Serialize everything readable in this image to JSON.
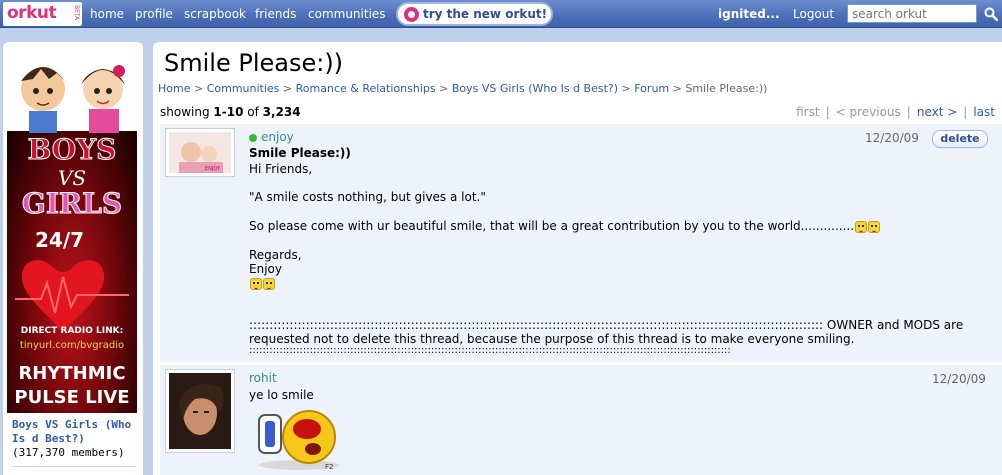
{
  "header": {
    "logo": "orkut",
    "logo_beta": "BETA",
    "nav": [
      "home",
      "profile",
      "scrapbook",
      "friends",
      "communities"
    ],
    "try_new": "try the new orkut!",
    "user": "ignited...",
    "logout": "Logout",
    "search_placeholder": "search orkut"
  },
  "sidebar": {
    "banner": {
      "title_line1": "BOYS",
      "title_vs": "VS",
      "title_line2": "GIRLS",
      "schedule": "24/7",
      "radio_label": "DIRECT RADIO LINK:",
      "radio_url": "tinyurl.com/bvgradio",
      "station_line1": "RHYTHMIC",
      "station_line2": "PULSE LIVE"
    },
    "community_name": "Boys VS Girls (Who Is d Best?)",
    "members": "(317,370 members)"
  },
  "main": {
    "title": "Smile Please:))",
    "breadcrumb": [
      "Home",
      "Communities",
      "Romance & Relationships",
      "Boys VS Girls (Who Is d Best?)",
      "Forum"
    ],
    "breadcrumb_sep": ">",
    "breadcrumb_current": "Smile Please:))",
    "showing_prefix": "showing",
    "showing_range": "1-10",
    "showing_of": "of",
    "showing_total": "3,234",
    "pager": {
      "first": "first",
      "previous": "< previous",
      "next": "next >",
      "last": "last",
      "sep": "|"
    }
  },
  "posts": [
    {
      "author": "enjoy",
      "date": "12/20/09",
      "delete_label": "delete",
      "subject": "Smile Please:))",
      "lines": [
        "Hi Friends,",
        "\"A smile costs nothing, but gives a lot.\"",
        "So please come with ur beautiful smile, that will be a great contribution by you to the world..............",
        "Regards,",
        "Enjoy",
        ":::::::::::::::::::::::::::::::::::::::::::::::::::::::::::::::::::::::::::::::::::::::::::::::::::::::::::::::::::::::::::::::::::::::::::::: OWNER and MODS are",
        "requested not to delete this thread, because the purpose of this thread is to make everyone smiling.",
        ":::::::::::::::::::::::::::::::::::::::::::::::::::::::::::::::::::::::::::::::::::::::::::::::::::::::::::::::::::::::::::::::::::::::::::::::"
      ],
      "thumb_caption": "ENJOY"
    },
    {
      "author": "rohit",
      "date": "12/20/09",
      "lines": [
        "ye lo smile"
      ],
      "image_caption": "F2"
    }
  ],
  "colors": {
    "topbar": "#4a6fb8",
    "page_bg": "#bfd0ea",
    "link": "#2f5aa8",
    "author_link": "#2f8a9a",
    "post_bg": "#eef3fb",
    "brand_pink": "#e0307b"
  },
  "icons": [
    "search-icon",
    "online-status-icon",
    "smiley-icon",
    "try-orkut-icon"
  ]
}
